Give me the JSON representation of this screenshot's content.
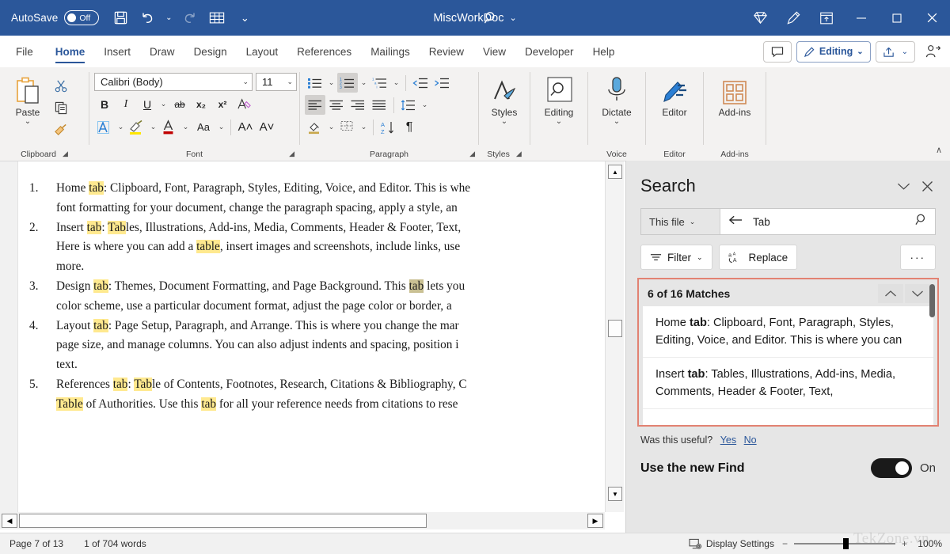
{
  "titlebar": {
    "autosave_label": "AutoSave",
    "autosave_state": "Off",
    "save_icon": "save-icon",
    "undo_icon": "undo-icon",
    "redo_icon": "redo-icon",
    "table_icon": "table-icon",
    "customize_icon": "customize-quick-access-icon",
    "document_title": "MiscWorkDoc",
    "title_caret": "⌄",
    "search_icon": "search-icon",
    "diamond_icon": "copilot-diamond-icon",
    "pen_icon": "pen-annotate-icon",
    "upload_icon": "restore-up-icon",
    "minimize": "–",
    "maximize": "□",
    "close": "✕",
    "brand_color": "#2b579a"
  },
  "tabs": [
    {
      "label": "File",
      "active": false
    },
    {
      "label": "Home",
      "active": true
    },
    {
      "label": "Insert",
      "active": false
    },
    {
      "label": "Draw",
      "active": false
    },
    {
      "label": "Design",
      "active": false
    },
    {
      "label": "Layout",
      "active": false
    },
    {
      "label": "References",
      "active": false
    },
    {
      "label": "Mailings",
      "active": false
    },
    {
      "label": "Review",
      "active": false
    },
    {
      "label": "View",
      "active": false
    },
    {
      "label": "Developer",
      "active": false
    },
    {
      "label": "Help",
      "active": false
    }
  ],
  "tabstrip_right": {
    "comments_icon": "comment-icon",
    "editing_label": "Editing",
    "editing_icon": "pencil-icon",
    "editing_caret": "⌄",
    "share_icon": "share-icon",
    "share_caret": "⌄",
    "people_icon": "share-people-icon"
  },
  "ribbon": {
    "groups": [
      {
        "label": "Clipboard",
        "dialog_launcher": true
      },
      {
        "label": "Font",
        "dialog_launcher": true
      },
      {
        "label": "Paragraph",
        "dialog_launcher": true
      },
      {
        "label": "Styles",
        "dialog_launcher": true
      },
      {
        "label": "Voice",
        "dialog_launcher": false
      },
      {
        "label": "Editor",
        "dialog_launcher": false
      },
      {
        "label": "Add-ins",
        "dialog_launcher": false
      }
    ],
    "clipboard": {
      "paste_label": "Paste",
      "paste_caret": "⌄",
      "cut_icon": "scissors-icon",
      "copy_icon": "copy-icon",
      "format_painter_icon": "format-painter-icon"
    },
    "font": {
      "font_name": "Calibri (Body)",
      "font_size": "11",
      "bold": "B",
      "italic": "I",
      "underline": "U",
      "strikethrough": "ab",
      "subscript": "x₂",
      "superscript": "x²",
      "clear_formatting_icon": "clear-formatting-icon",
      "text_effects_icon": "text-effects-icon",
      "highlight_icon": "text-highlight-icon",
      "font_color_icon": "font-color-icon",
      "change_case": "Aa",
      "grow_font": "A˄",
      "shrink_font": "A˅"
    },
    "paragraph": {
      "bullets_icon": "bullet-list-icon",
      "numbering_icon": "numbered-list-icon",
      "multilevel_icon": "multilevel-list-icon",
      "decrease_indent_icon": "decrease-indent-icon",
      "increase_indent_icon": "increase-indent-icon",
      "align_left_icon": "align-left-icon",
      "align_center_icon": "align-center-icon",
      "align_right_icon": "align-right-icon",
      "justify_icon": "justify-icon",
      "line_spacing_icon": "line-spacing-icon",
      "shading_icon": "shading-icon",
      "borders_icon": "borders-icon",
      "sort_icon": "sort-icon",
      "show_marks_icon": "paragraph-marks-icon"
    },
    "styles": {
      "label": "Styles",
      "caret": "⌄",
      "icon": "styles-icon"
    },
    "editing": {
      "label": "Editing",
      "caret": "⌄",
      "icon": "find-icon"
    },
    "dictate": {
      "label": "Dictate",
      "caret": "⌄",
      "icon": "microphone-icon"
    },
    "editor": {
      "label": "Editor",
      "icon": "editor-pen-icon"
    },
    "addins": {
      "label": "Add-ins",
      "icon": "addins-grid-icon"
    },
    "collapse_caret": "∧"
  },
  "document": {
    "items": [
      {
        "number": "1.",
        "lines": [
          [
            {
              "t": "Home ",
              "h": "none"
            },
            {
              "t": "tab",
              "h": "yellow"
            },
            {
              "t": ": Clipboard, Font, Paragraph, Styles, Editing, Voice, and Editor. This is whe",
              "h": "none"
            }
          ],
          [
            {
              "t": "font formatting for your document, change the paragraph spacing, apply a style, an",
              "h": "none"
            }
          ]
        ]
      },
      {
        "number": "2.",
        "lines": [
          [
            {
              "t": "Insert ",
              "h": "none"
            },
            {
              "t": "tab",
              "h": "yellow"
            },
            {
              "t": ": ",
              "h": "none"
            },
            {
              "t": "Tab",
              "h": "yellow"
            },
            {
              "t": "les, Illustrations, Add-ins, Media, Comments, Header & Footer, Text,",
              "h": "none"
            }
          ],
          [
            {
              "t": "Here is where you can add a ",
              "h": "none"
            },
            {
              "t": "table",
              "h": "yellow"
            },
            {
              "t": ", insert images and screenshots, include links, use",
              "h": "none"
            }
          ],
          [
            {
              "t": "more.",
              "h": "none"
            }
          ]
        ]
      },
      {
        "number": "3.",
        "lines": [
          [
            {
              "t": "Design ",
              "h": "none"
            },
            {
              "t": "tab",
              "h": "yellow"
            },
            {
              "t": ": Themes, Document Formatting, and Page Background. This ",
              "h": "none"
            },
            {
              "t": "tab",
              "h": "current"
            },
            {
              "t": " lets you",
              "h": "none"
            }
          ],
          [
            {
              "t": "color scheme, use a particular document format, adjust the page color or border, a",
              "h": "none"
            }
          ]
        ]
      },
      {
        "number": "4.",
        "lines": [
          [
            {
              "t": "Layout ",
              "h": "none"
            },
            {
              "t": "tab",
              "h": "yellow"
            },
            {
              "t": ": Page Setup, Paragraph, and Arrange. This is where you change the mar",
              "h": "none"
            }
          ],
          [
            {
              "t": "page size, and manage columns. You can also adjust indents and spacing, position i",
              "h": "none"
            }
          ],
          [
            {
              "t": "text.",
              "h": "none"
            }
          ]
        ]
      },
      {
        "number": "5.",
        "lines": [
          [
            {
              "t": "References ",
              "h": "none"
            },
            {
              "t": "tab",
              "h": "yellow"
            },
            {
              "t": ": ",
              "h": "none"
            },
            {
              "t": "Tab",
              "h": "yellow"
            },
            {
              "t": "le of Contents, Footnotes, Research, Citations & Bibliography, C",
              "h": "none"
            }
          ],
          [
            {
              "t": "Table",
              "h": "yellow"
            },
            {
              "t": " of Authorities. Use this ",
              "h": "none"
            },
            {
              "t": "tab",
              "h": "yellow"
            },
            {
              "t": " for all your reference needs from citations to rese",
              "h": "none"
            }
          ]
        ]
      }
    ],
    "scroll_up_arrow": "▲",
    "scroll_down_arrow": "▼",
    "scroll_left_arrow": "◀",
    "scroll_right_arrow": "▶",
    "highlight_color": "#ffe98f",
    "current_highlight_color": "#c9c093"
  },
  "search_pane": {
    "title": "Search",
    "collapse_icon": "chevron-down-icon",
    "close_icon": "close-icon",
    "scope_label": "This file",
    "scope_caret": "⌄",
    "back_icon": "back-arrow-icon",
    "query": "Tab",
    "query_placeholder": "Search",
    "search_icon": "search-icon",
    "filter_label": "Filter",
    "filter_icon": "filter-icon",
    "filter_caret": "⌄",
    "replace_label": "Replace",
    "replace_icon": "replace-icon",
    "more_label": "···",
    "results_count": "6 of 16 Matches",
    "prev_icon": "chevron-up-icon",
    "next_icon": "chevron-down-icon",
    "highlight_border_color": "#e28272",
    "results": [
      {
        "pre": "Home ",
        "bold": "tab",
        "post": ": Clipboard, Font, Paragraph, Styles, Editing, Voice, and Editor. This is where you can"
      },
      {
        "pre": "Insert ",
        "bold": "tab",
        "post": ": Tables, Illustrations, Add-ins, Media, Comments, Header & Footer, Text,"
      }
    ],
    "feedback_question": "Was this useful?",
    "feedback_yes": "Yes",
    "feedback_no": "No",
    "new_find_label": "Use the new Find",
    "new_find_state": "On"
  },
  "statusbar": {
    "page": "Page 7 of 13",
    "words": "1 of 704 words",
    "display_settings": "Display Settings",
    "display_settings_icon": "display-settings-icon",
    "zoom_out": "−",
    "zoom_in": "+",
    "zoom_level": "100%"
  },
  "watermark": "TekZone.vn"
}
